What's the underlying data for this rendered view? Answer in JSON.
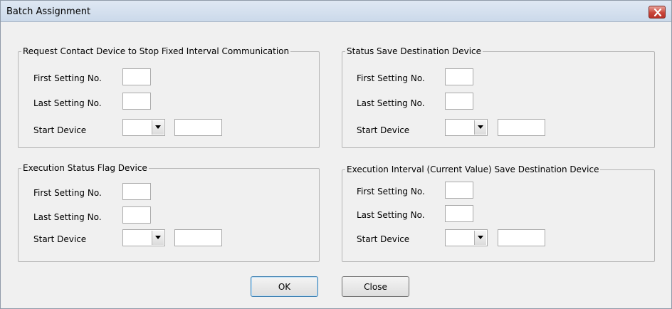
{
  "window": {
    "title": "Batch Assignment"
  },
  "groups": {
    "request_contact": {
      "legend": "Request Contact Device to Stop Fixed Interval Communication",
      "first_label": "First Setting No.",
      "last_label": "Last Setting No.",
      "start_label": "Start Device"
    },
    "status_save": {
      "legend": "Status Save Destination Device",
      "first_label": "First Setting No.",
      "last_label": "Last Setting No.",
      "start_label": "Start Device"
    },
    "execution_flag": {
      "legend": "Execution Status Flag Device",
      "first_label": "First Setting No.",
      "last_label": "Last Setting No.",
      "start_label": "Start Device"
    },
    "execution_interval": {
      "legend": "Execution Interval (Current Value) Save Destination Device",
      "first_label": "First Setting No.",
      "last_label": "Last Setting No.",
      "start_label": "Start Device"
    }
  },
  "buttons": {
    "ok": "OK",
    "close": "Close"
  },
  "icons": {
    "close": "close-icon",
    "dropdown": "chevron-down-icon"
  },
  "colors": {
    "title_bar": "#cbd9ea",
    "close_button": "#c9453a",
    "dialog_bg": "#f0f0f0"
  }
}
